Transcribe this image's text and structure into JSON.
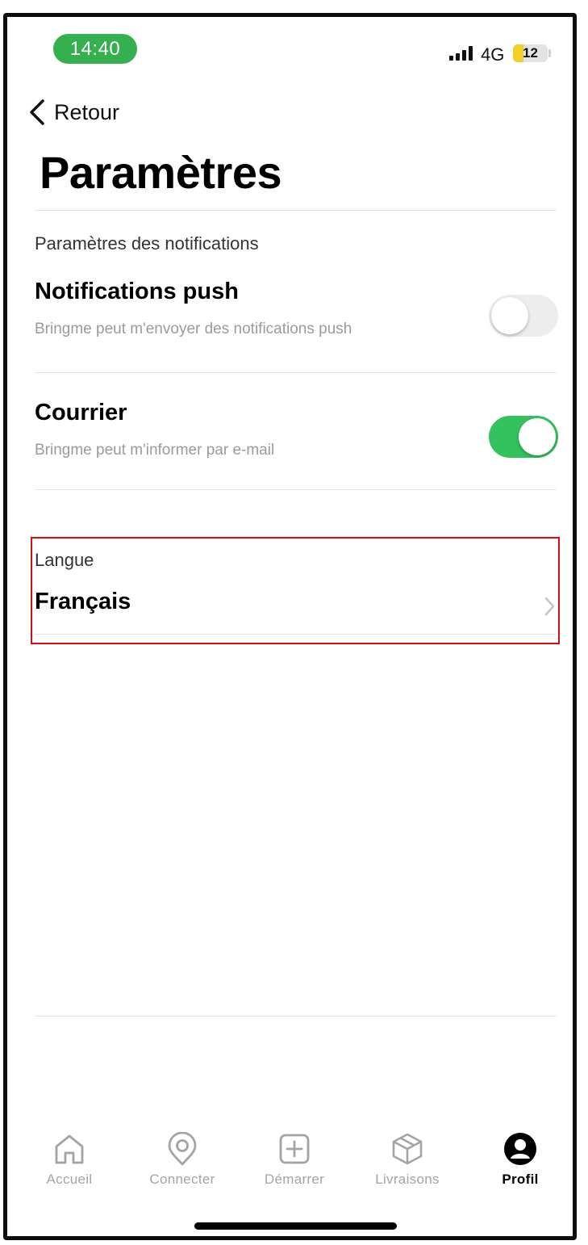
{
  "status_bar": {
    "time": "14:40",
    "network": "4G",
    "battery_level": "12",
    "battery_fraction": 0.3,
    "accent_color": "#34b04f"
  },
  "header": {
    "back_label": "Retour",
    "title": "Paramètres"
  },
  "notifications": {
    "section_label": "Paramètres des notifications",
    "push": {
      "title": "Notifications push",
      "subtitle": "Bringme peut m'envoyer des notifications push",
      "enabled": false
    },
    "mail": {
      "title": "Courrier",
      "subtitle": "Bringme peut m'informer par e-mail",
      "enabled": true
    }
  },
  "language": {
    "section_label": "Langue",
    "value": "Français"
  },
  "tabbar": {
    "items": [
      {
        "label": "Accueil",
        "icon": "home-icon",
        "active": false
      },
      {
        "label": "Connecter",
        "icon": "location-pin-icon",
        "active": false
      },
      {
        "label": "Démarrer",
        "icon": "plus-square-icon",
        "active": false
      },
      {
        "label": "Livraisons",
        "icon": "package-icon",
        "active": false
      },
      {
        "label": "Profil",
        "icon": "profile-icon",
        "active": true
      }
    ]
  },
  "colors": {
    "toggle_on": "#33c25c",
    "toggle_off": "#ededed",
    "highlight": "#d50f0f"
  }
}
